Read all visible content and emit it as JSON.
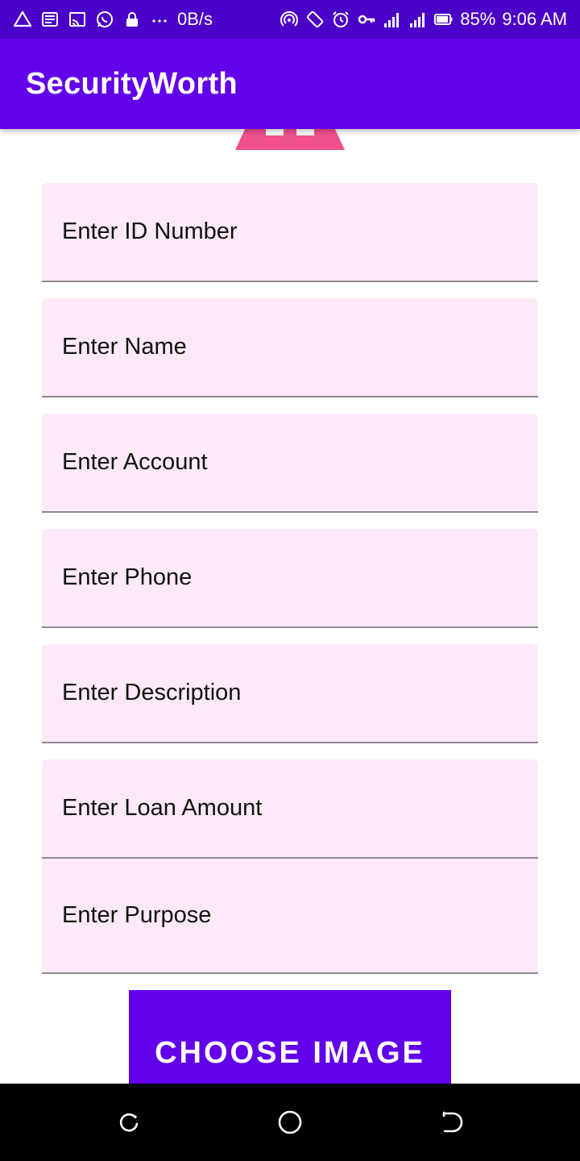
{
  "status_bar": {
    "left_icons": [
      "warning-icon",
      "news-icon",
      "cast-icon",
      "whatsapp-icon",
      "lock-icon",
      "more-icon"
    ],
    "speed": "0B/s",
    "right_icons": [
      "hotspot-icon",
      "rotate-icon",
      "alarm-icon",
      "vpn-key-icon",
      "signal-h-plus-icon",
      "signal-r-icon",
      "vibrate-icon",
      "battery-icon"
    ],
    "battery": "85%",
    "time": "9:06 AM"
  },
  "app_bar": {
    "title": "SecurityWorth"
  },
  "form": {
    "fields": [
      {
        "label": "Enter ID Number"
      },
      {
        "label": "Enter Name"
      },
      {
        "label": "Enter Account"
      },
      {
        "label": "Enter Phone"
      },
      {
        "label": "Enter Description"
      },
      {
        "label": "Enter Loan Amount"
      },
      {
        "label": "Enter Purpose"
      }
    ],
    "choose_image_label": "Choose Image"
  },
  "nav_bar": {
    "buttons": [
      "recents-icon",
      "home-icon",
      "back-icon"
    ]
  },
  "colors": {
    "status_bar": "#4b00c8",
    "primary": "#6200ea",
    "field_bg": "#fde9f7",
    "field_underline": "#8f8a92",
    "logo_accent": "#f0508c"
  }
}
